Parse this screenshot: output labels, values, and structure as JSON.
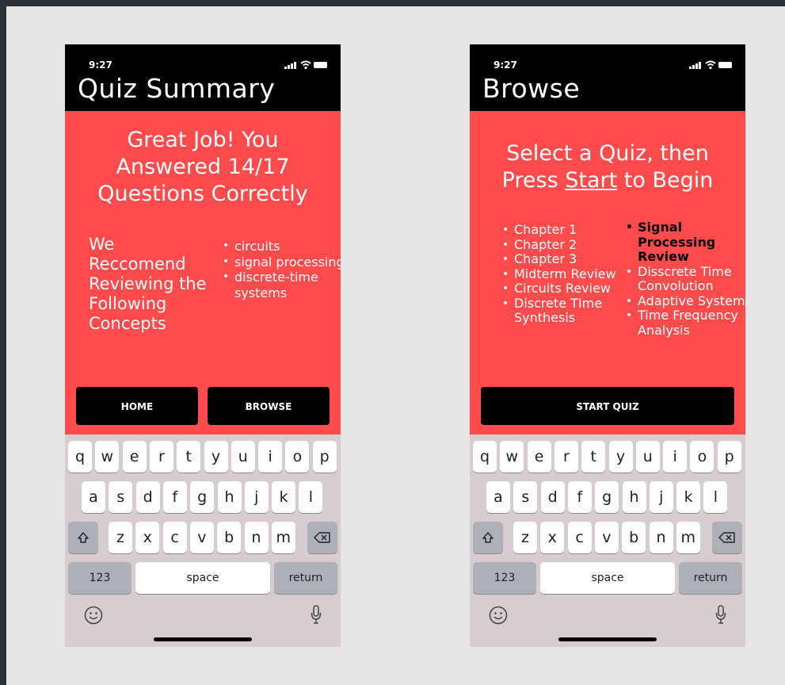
{
  "summary": {
    "time": "9:27",
    "title": "Quiz Summary",
    "headline": [
      "Great Job!  You",
      "Answered 14/17",
      "Questions Correctly"
    ],
    "recommend_text": "We Reccomend Reviewing the Following Concepts",
    "concepts": [
      "circuits",
      "signal processing",
      "discrete-time systems"
    ],
    "home_label": "HOME",
    "browse_label": "BROWSE"
  },
  "browse": {
    "time": "9:27",
    "title": "Browse",
    "headline_line1": "Select a Quiz, then",
    "headline_pre": "Press ",
    "headline_link": "Start",
    "headline_post": " to Begin",
    "chapters": [
      "Chapter 1",
      "Chapter 2",
      "Chapter 3",
      "Midterm Review",
      "Circuits Review",
      "Discrete TIme Synthesis"
    ],
    "topics": [
      "Signal Processing Review",
      "Disscrete Time Convolution",
      "Adaptive Systems",
      "Time Frequency Analysis"
    ],
    "selected_topic": "Signal Processing Review",
    "start_label": "START QUIZ"
  },
  "keyboard": {
    "row1": [
      "q",
      "w",
      "e",
      "r",
      "t",
      "y",
      "u",
      "i",
      "o",
      "p"
    ],
    "row2": [
      "a",
      "s",
      "d",
      "f",
      "g",
      "h",
      "j",
      "k",
      "l"
    ],
    "row3": [
      "z",
      "x",
      "c",
      "v",
      "b",
      "n",
      "m"
    ],
    "numbers_label": "123",
    "space_label": "space",
    "return_label": "return"
  },
  "icons": [
    "signal-icon",
    "wifi-icon",
    "battery-icon",
    "shift-icon",
    "delete-icon",
    "emoji-icon",
    "mic-icon"
  ],
  "colors": {
    "accent": "#ff4b4b",
    "header": "#000000",
    "keyboard_bg": "#d7cdd0",
    "canvas": "#e6e6e6"
  }
}
